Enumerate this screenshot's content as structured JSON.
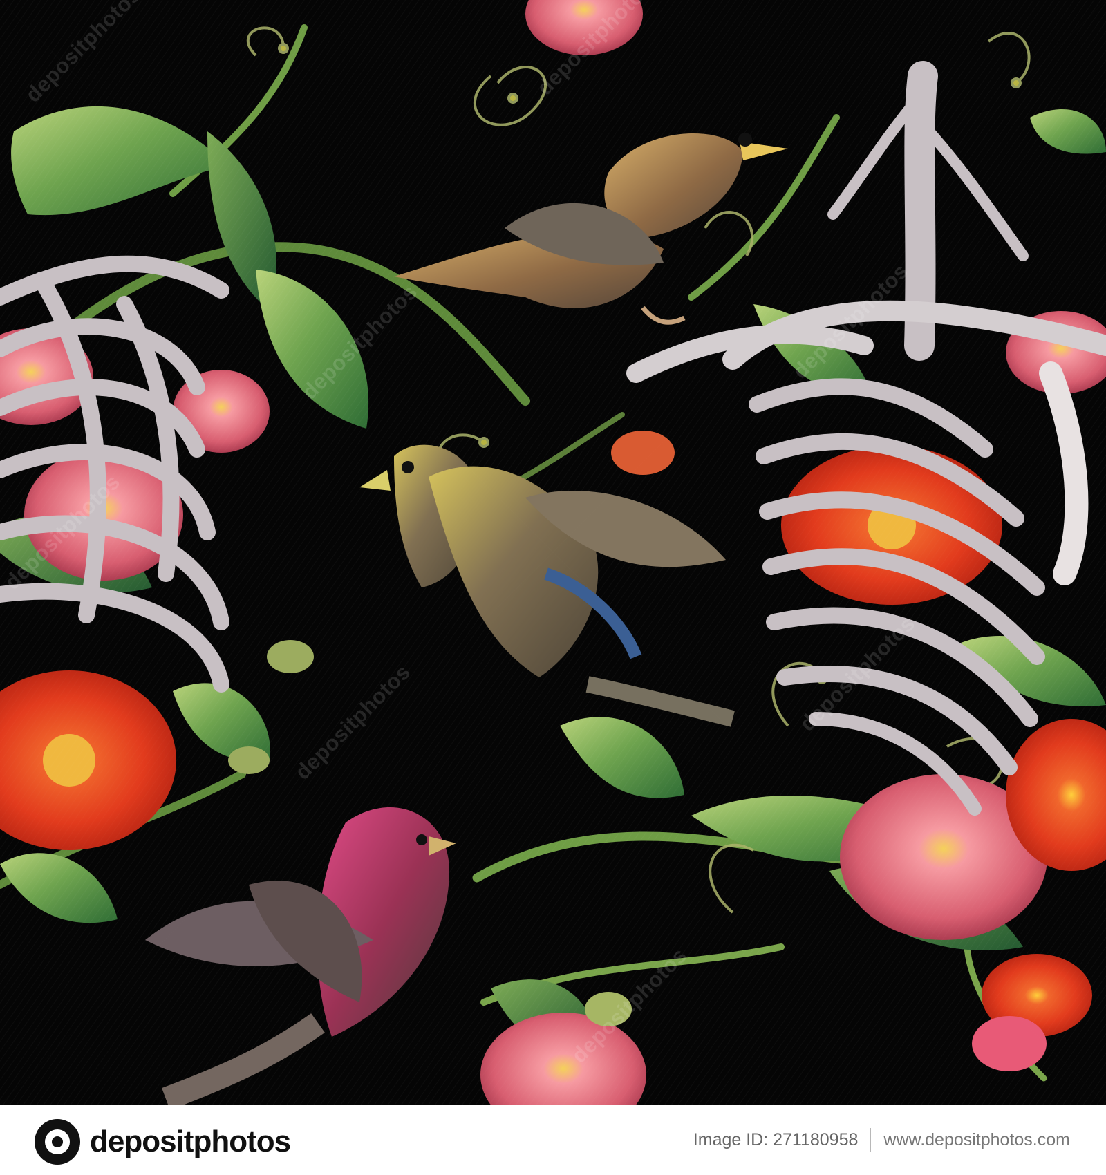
{
  "artwork": {
    "background": "#050505",
    "watermarks": [
      "depositphotos",
      "depositphotos",
      "depositphotos",
      "depositphotos",
      "depositphotos",
      "depositphotos",
      "depositphotos",
      "depositphotos"
    ]
  },
  "footer": {
    "brand": "depositphotos",
    "image_id": "Image ID: 271180958",
    "url": "www.depositphotos.com"
  },
  "icons": {
    "brand": "depositphotos-logo-icon"
  }
}
